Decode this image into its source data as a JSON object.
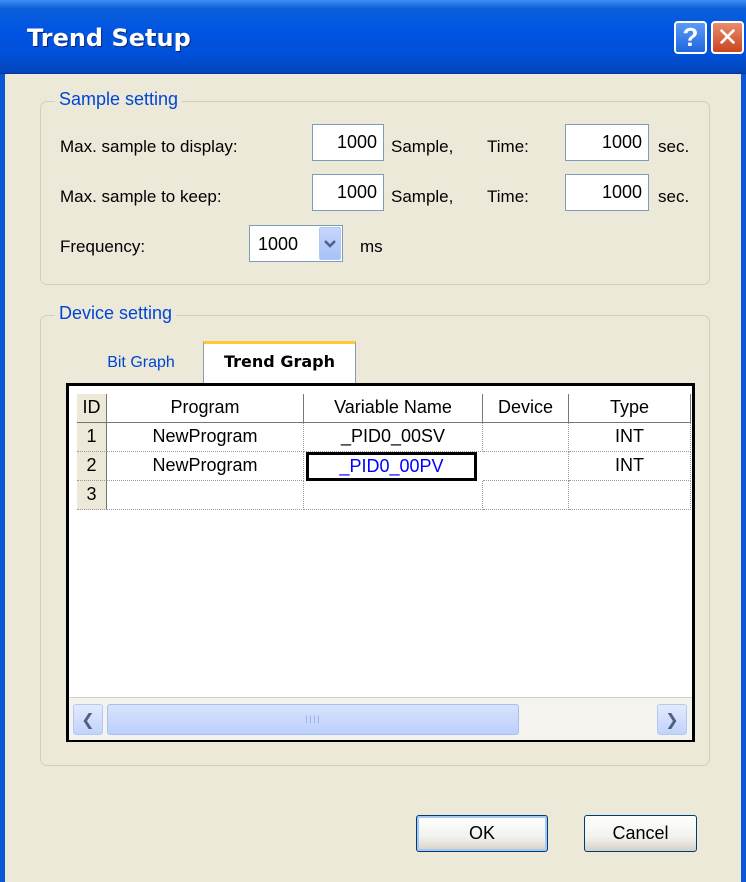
{
  "window": {
    "title": "Trend Setup",
    "help_glyph": "?",
    "close_glyph": "✕"
  },
  "sample_setting": {
    "legend": "Sample setting",
    "display_label": "Max. sample to display:",
    "display_samples": "1000",
    "keep_label": "Max. sample to keep:",
    "keep_samples": "1000",
    "sample_unit": "Sample,",
    "time_label": "Time:",
    "display_time": "1000",
    "keep_time": "1000",
    "time_unit": "sec.",
    "frequency_label": "Frequency:",
    "frequency_value": "1000",
    "frequency_unit": "ms"
  },
  "device_setting": {
    "legend": "Device setting",
    "tabs": [
      {
        "label": "Bit Graph",
        "active": false
      },
      {
        "label": "Trend Graph",
        "active": true
      }
    ],
    "columns": [
      "ID",
      "Program",
      "Variable Name",
      "Device",
      "Type"
    ],
    "rows": [
      {
        "id": "1",
        "program": "NewProgram",
        "variable": "_PID0_00SV",
        "device": "",
        "type": "INT"
      },
      {
        "id": "2",
        "program": "NewProgram",
        "variable": "_PID0_00PV",
        "device": "",
        "type": "INT"
      },
      {
        "id": "3",
        "program": "",
        "variable": "",
        "device": "",
        "type": ""
      }
    ],
    "scroll_left_glyph": "❮",
    "scroll_right_glyph": "❯",
    "scroll_thumb_grip": "IIII"
  },
  "buttons": {
    "ok": "OK",
    "cancel": "Cancel"
  },
  "colors": {
    "title_bar": "#0054E3",
    "group_legend": "#0046D5",
    "dialog_bg": "#ECE9D8",
    "active_tab_accent": "#FFC73C",
    "editing_cell_text": "#0000FF"
  },
  "icons": {
    "help": "help-icon",
    "close": "close-icon",
    "dropdown": "chevron-down-icon",
    "scroll_left": "arrow-left-icon",
    "scroll_right": "arrow-right-icon"
  }
}
